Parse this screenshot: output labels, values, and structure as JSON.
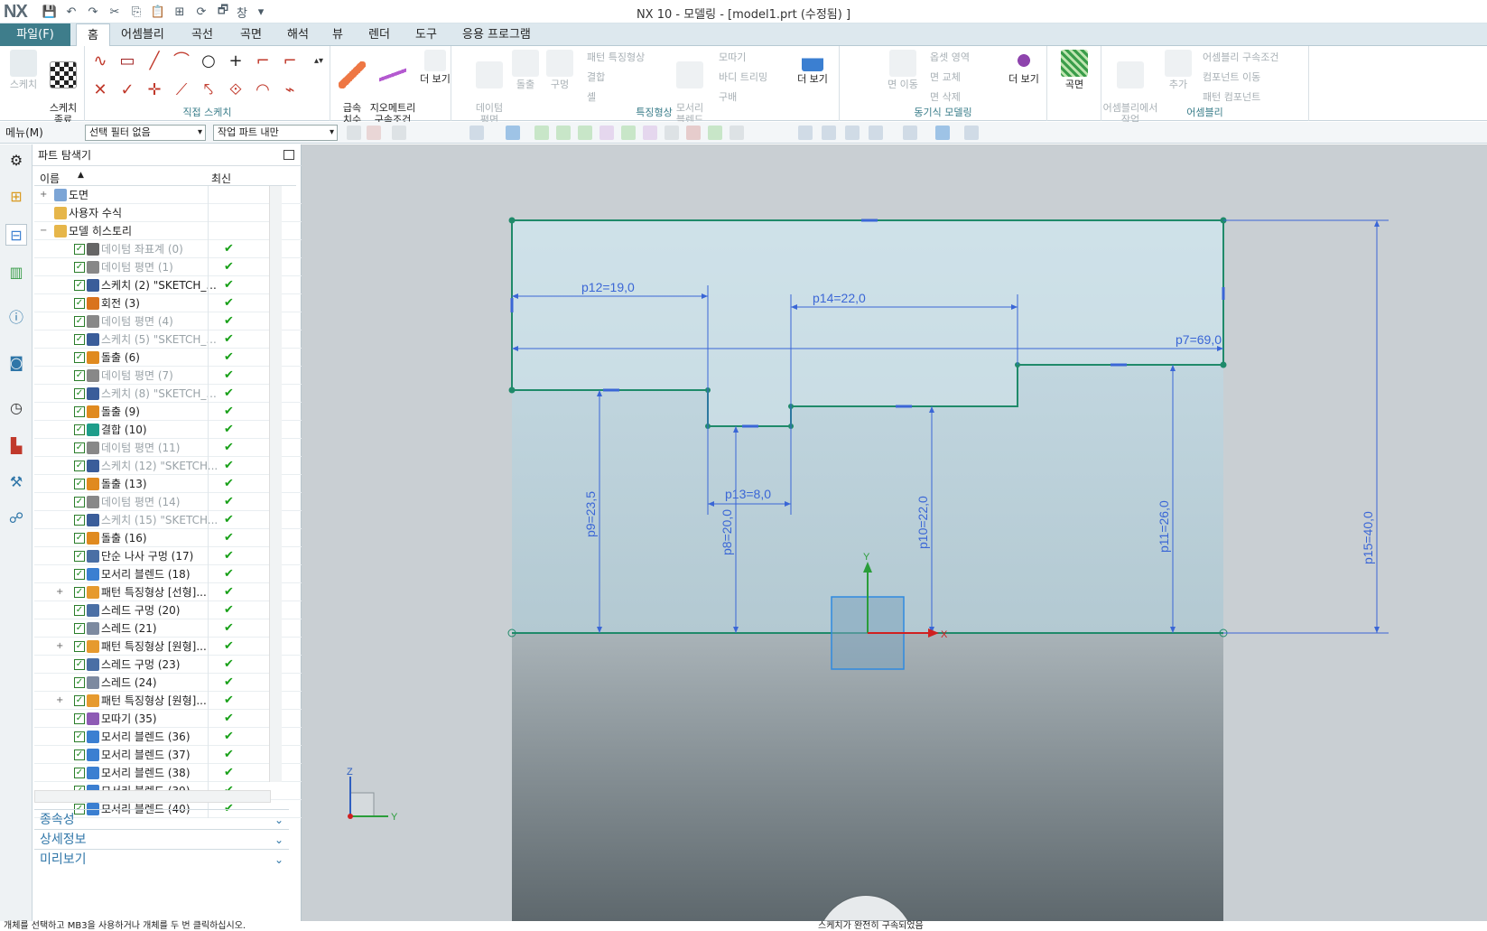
{
  "title_bar": {
    "logo": "NX",
    "window_title": "NX 10 - 모델링 - [model1.prt (수정됨) ]",
    "window_menu": "창"
  },
  "tabs": [
    {
      "label": "파일(F)"
    },
    {
      "label": "홈"
    },
    {
      "label": "어셈블리"
    },
    {
      "label": "곡선"
    },
    {
      "label": "곡면"
    },
    {
      "label": "해석"
    },
    {
      "label": "뷰"
    },
    {
      "label": "렌더"
    },
    {
      "label": "도구"
    },
    {
      "label": "응용 프로그램"
    }
  ],
  "ribbon": {
    "sketch": "스케치",
    "finish_sketch": "스케치\n종료",
    "direct_sketch": "직접 스케치",
    "rapid_dim": "급속\n치수",
    "geom_con": "지오메트리\n구속조건",
    "more1": "더 보기",
    "datum_plane": "데이텀\n평면",
    "extrude": "돌출",
    "hole": "구멍",
    "pattern_feature": "패턴 특징형상",
    "combine": "결합",
    "shell": "셸",
    "edge_blend": "모서리\n블렌드",
    "chamfer": "모따기",
    "draft": "바디 트리밍",
    "draft2": "구배",
    "feature": "특징형상",
    "more2": "더 보기",
    "move_face": "면 이동",
    "offset_region": "옵셋 영역",
    "replace_face": "면 교체",
    "delete_face": "면 삭제",
    "sync_modeling": "동기식 모델링",
    "more3": "더 보기",
    "surface": "곡면",
    "work_in_assembly": "어셈블리에서\n작업",
    "add": "추가",
    "assembly_constraints": "어셈블리 구속조건",
    "component_move": "컴포넌트 이동",
    "pattern_component": "패턴 컴포넌트",
    "assembly": "어셈블리"
  },
  "cmdbar": {
    "menu": "메뉴(M)",
    "filter": "선택 필터 없음",
    "scope": "작업 파트 내만"
  },
  "navigator": {
    "title": "파트 탐색기",
    "col_name": "이름",
    "col_latest": "최신",
    "rows": [
      {
        "name": "도면",
        "level": 0,
        "gray": false,
        "check": false,
        "exp": "+",
        "ok": false,
        "icon": "#7ca5d6"
      },
      {
        "name": "사용자 수식",
        "level": 0,
        "gray": false,
        "check": false,
        "exp": "",
        "ok": false,
        "icon": "#e6b64a"
      },
      {
        "name": "모델 히스토리",
        "level": 0,
        "gray": false,
        "check": false,
        "exp": "−",
        "ok": false,
        "icon": "#e6b64a"
      },
      {
        "name": "데이텀 좌표계 (0)",
        "gray": true,
        "check": true,
        "ok": true,
        "icon": "#666"
      },
      {
        "name": "데이텀 평면 (1)",
        "gray": true,
        "check": true,
        "ok": true,
        "icon": "#888"
      },
      {
        "name": "스케치 (2) \"SKETCH_...",
        "gray": false,
        "check": true,
        "ok": true,
        "icon": "#3a5d9a"
      },
      {
        "name": "회전 (3)",
        "gray": false,
        "check": true,
        "ok": true,
        "icon": "#d9731d"
      },
      {
        "name": "데이텀 평면 (4)",
        "gray": true,
        "check": true,
        "ok": true,
        "icon": "#888"
      },
      {
        "name": "스케치 (5) \"SKETCH_...",
        "gray": true,
        "check": true,
        "ok": true,
        "icon": "#3a5d9a"
      },
      {
        "name": "돌출 (6)",
        "gray": false,
        "check": true,
        "ok": true,
        "icon": "#e08a1f"
      },
      {
        "name": "데이텀 평면 (7)",
        "gray": true,
        "check": true,
        "ok": true,
        "icon": "#888"
      },
      {
        "name": "스케치 (8) \"SKETCH_...",
        "gray": true,
        "check": true,
        "ok": true,
        "icon": "#3a5d9a"
      },
      {
        "name": "돌출 (9)",
        "gray": false,
        "check": true,
        "ok": true,
        "icon": "#e08a1f"
      },
      {
        "name": "결합 (10)",
        "gray": false,
        "check": true,
        "ok": true,
        "icon": "#1e9d8a"
      },
      {
        "name": "데이텀 평면 (11)",
        "gray": true,
        "check": true,
        "ok": true,
        "icon": "#888"
      },
      {
        "name": "스케치 (12) \"SKETCH...",
        "gray": true,
        "check": true,
        "ok": true,
        "icon": "#3a5d9a"
      },
      {
        "name": "돌출 (13)",
        "gray": false,
        "check": true,
        "ok": true,
        "icon": "#e08a1f"
      },
      {
        "name": "데이텀 평면 (14)",
        "gray": true,
        "check": true,
        "ok": true,
        "icon": "#888"
      },
      {
        "name": "스케치 (15) \"SKETCH...",
        "gray": true,
        "check": true,
        "ok": true,
        "icon": "#3a5d9a"
      },
      {
        "name": "돌출 (16)",
        "gray": false,
        "check": true,
        "ok": true,
        "icon": "#e08a1f"
      },
      {
        "name": "단순 나사 구멍 (17)",
        "gray": false,
        "check": true,
        "ok": true,
        "icon": "#4a6fa5"
      },
      {
        "name": "모서리 블렌드 (18)",
        "gray": false,
        "check": true,
        "ok": true,
        "icon": "#3b7fd1"
      },
      {
        "name": "패턴 특징형상 [선형]...",
        "gray": false,
        "check": true,
        "ok": true,
        "icon": "#e69a2e",
        "exp": "+"
      },
      {
        "name": "스레드 구멍 (20)",
        "gray": false,
        "check": true,
        "ok": true,
        "icon": "#4a6fa5"
      },
      {
        "name": "스레드 (21)",
        "gray": false,
        "check": true,
        "ok": true,
        "icon": "#7d8aa0"
      },
      {
        "name": "패턴 특징형상 [원형]...",
        "gray": false,
        "check": true,
        "ok": true,
        "icon": "#e69a2e",
        "exp": "+"
      },
      {
        "name": "스레드 구멍 (23)",
        "gray": false,
        "check": true,
        "ok": true,
        "icon": "#4a6fa5"
      },
      {
        "name": "스레드 (24)",
        "gray": false,
        "check": true,
        "ok": true,
        "icon": "#7d8aa0"
      },
      {
        "name": "패턴 특징형상 [원형]...",
        "gray": false,
        "check": true,
        "ok": true,
        "icon": "#e69a2e",
        "exp": "+"
      },
      {
        "name": "모따기 (35)",
        "gray": false,
        "check": true,
        "ok": true,
        "icon": "#8e5bb5"
      },
      {
        "name": "모서리 블렌드 (36)",
        "gray": false,
        "check": true,
        "ok": true,
        "icon": "#3b7fd1"
      },
      {
        "name": "모서리 블렌드 (37)",
        "gray": false,
        "check": true,
        "ok": true,
        "icon": "#3b7fd1"
      },
      {
        "name": "모서리 블렌드 (38)",
        "gray": false,
        "check": true,
        "ok": true,
        "icon": "#3b7fd1"
      },
      {
        "name": "모서리 블렌드 (39)",
        "gray": false,
        "check": true,
        "ok": true,
        "icon": "#3b7fd1"
      },
      {
        "name": "모서리 블렌드 (40)",
        "gray": false,
        "check": true,
        "ok": true,
        "icon": "#3b7fd1"
      }
    ],
    "panels": [
      "종속성",
      "상세정보",
      "미리보기"
    ]
  },
  "sketch": {
    "dims": {
      "p12": "p12=19,0",
      "p14": "p14=22,0",
      "p7": "p7=69,0",
      "p13": "p13=8,0",
      "p9": "p9=23,5",
      "p8": "p8=20,0",
      "p10": "p10=22,0",
      "p11": "p11=26,0",
      "p15": "p15=40,0"
    },
    "axes": {
      "x": "X",
      "y": "Y",
      "z": "Z",
      "y2": "Y"
    }
  },
  "status": {
    "left": "개체를 선택하고 MB3을 사용하거나 개체를 두 번 클릭하십시오.",
    "right": "스케치가 완전히 구속되었음"
  }
}
